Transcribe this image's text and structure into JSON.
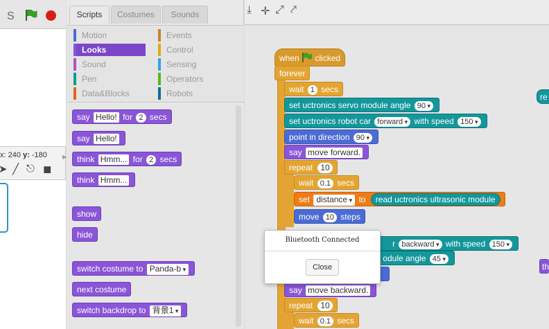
{
  "stage": {
    "title_letter": "S",
    "coords_x_label": "x:",
    "coords_x": "240",
    "coords_y_label": "y:",
    "coords_y": "-180"
  },
  "tabs": [
    {
      "label": "Scripts"
    },
    {
      "label": "Costumes"
    },
    {
      "label": "Sounds"
    }
  ],
  "categories": {
    "left": [
      "Motion",
      "Looks",
      "Sound",
      "Pen",
      "Data&Blocks"
    ],
    "right": [
      "Events",
      "Control",
      "Sensing",
      "Operators",
      "Robots"
    ],
    "selected": "Looks"
  },
  "palette": {
    "say_for": {
      "say": "say",
      "text": "Hello!",
      "for": "for",
      "secs_value": "2",
      "secs": "secs"
    },
    "say": {
      "say": "say",
      "text": "Hello!"
    },
    "think_for": {
      "think": "think",
      "text": "Hmm...",
      "for": "for",
      "secs_value": "2",
      "secs": "secs"
    },
    "think": {
      "think": "think",
      "text": "Hmm..."
    },
    "show": "show",
    "hide": "hide",
    "switch_costume": {
      "label": "switch costume to",
      "value": "Panda-b"
    },
    "next_costume": "next costume",
    "switch_backdrop": {
      "label": "switch backdrop to",
      "value": "背景1"
    }
  },
  "script": {
    "hat": {
      "when": "when",
      "clicked": "clicked"
    },
    "forever": "forever",
    "wait1": {
      "wait": "wait",
      "value": "1",
      "secs": "secs"
    },
    "servo1": {
      "label": "set uctronics servo module angle",
      "value": "90"
    },
    "car1": {
      "label": "set uctronics robot car",
      "dir": "forward",
      "with_speed": "with speed",
      "speed": "150"
    },
    "point": {
      "label": "point in direction",
      "value": "90"
    },
    "say1": {
      "say": "say",
      "text": "move forward."
    },
    "repeat1": {
      "repeat": "repeat",
      "value": "10"
    },
    "wait2": {
      "wait": "wait",
      "value": "0.1",
      "secs": "secs"
    },
    "setvar": {
      "set": "set",
      "var": "distance",
      "to": "to",
      "reporter": "read uctronics ultrasonic module"
    },
    "move": {
      "move": "move",
      "value": "10",
      "steps": "steps"
    },
    "car2": {
      "prefix": "r",
      "dir": "backward",
      "with_speed": "with speed",
      "speed": "150"
    },
    "servo2": {
      "label": "odule angle",
      "value": "45"
    },
    "say2": {
      "say": "say",
      "text": "move backward."
    },
    "repeat2": {
      "repeat": "repeat",
      "value": "10"
    },
    "wait3": {
      "wait": "wait",
      "value": "0.1",
      "secs": "secs"
    },
    "edge_re": "re",
    "edge_th": "th"
  },
  "modal": {
    "title": "Bluetooth Connected",
    "close_label": "Close"
  },
  "colors": {
    "looks": "#8a55d7",
    "teal": "#14979b",
    "events": "#d89a2c",
    "control": "#e4a434",
    "motion": "#4a6cd4"
  }
}
